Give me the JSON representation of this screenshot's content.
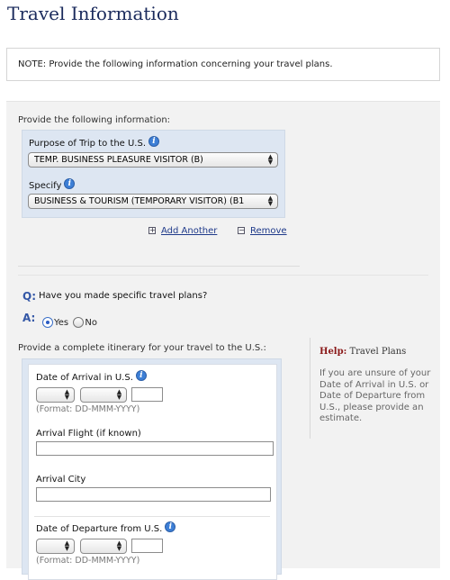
{
  "page": {
    "title": "Travel Information"
  },
  "note": {
    "text": "NOTE: Provide the following information concerning your travel plans."
  },
  "form": {
    "intro": "Provide the following information:",
    "purpose": {
      "label": "Purpose of Trip to the U.S.",
      "value": "TEMP. BUSINESS PLEASURE VISITOR (B)"
    },
    "specify": {
      "label": "Specify",
      "value": "BUSINESS & TOURISM (TEMPORARY VISITOR) (B1"
    },
    "add_another": "Add Another",
    "remove": "Remove",
    "add_icon": "+",
    "remove_icon": "−"
  },
  "question": {
    "q_label": "Q:",
    "text": "Have you made specific travel plans?",
    "a_label": "A:",
    "options": [
      "Yes",
      "No"
    ],
    "selected": "Yes"
  },
  "itinerary": {
    "intro": "Provide a complete itinerary for your travel to the U.S.:",
    "arrival_date": {
      "label": "Date of Arrival in U.S.",
      "hint": "(Format: DD-MMM-YYYY)"
    },
    "arrival_flight": {
      "label": "Arrival Flight (if known)"
    },
    "arrival_city": {
      "label": "Arrival City"
    },
    "departure_date": {
      "label": "Date of Departure from U.S.",
      "hint": "(Format: DD-MMM-YYYY)"
    }
  },
  "help": {
    "prefix": "Help:",
    "title": "Travel Plans",
    "body": "If you are unsure of your Date of Arrival in U.S. or Date of Departure from U.S., please provide an estimate."
  },
  "icons": {
    "info": "info-icon",
    "select_arrows": "up-down-arrows-icon"
  },
  "colors": {
    "title": "#1a2a5c",
    "accent_blue": "#3357a6",
    "link": "#1f3a8a",
    "help_red": "#8b1a1a",
    "panel_blue": "#dde6f2"
  }
}
